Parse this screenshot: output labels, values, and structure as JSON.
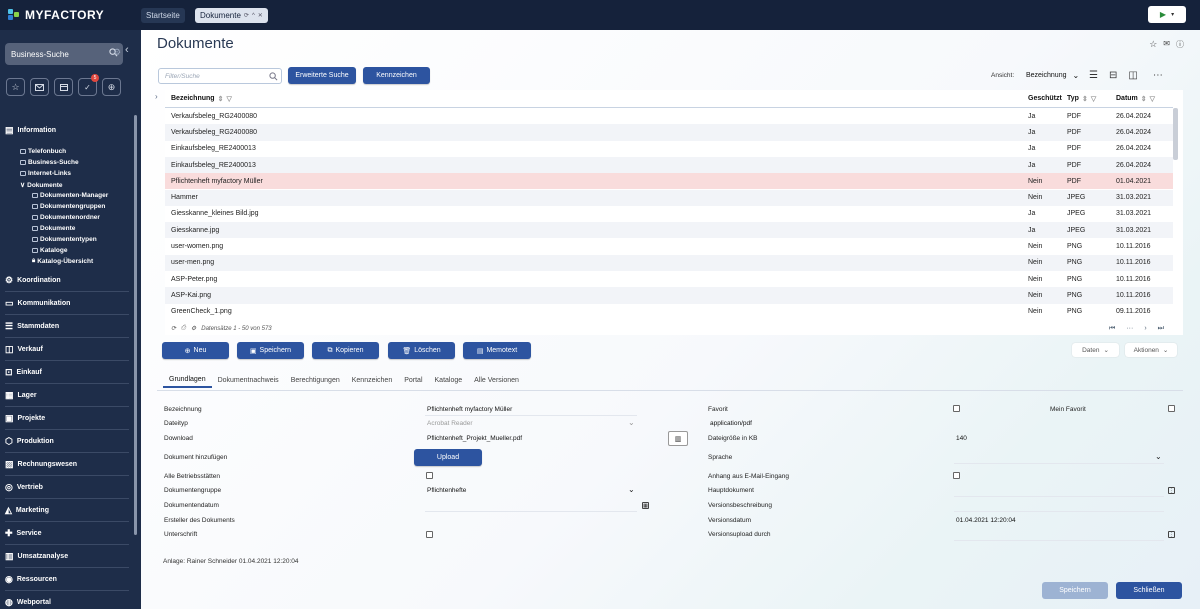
{
  "app": {
    "name": "MYFACTORY"
  },
  "tabs": [
    {
      "label": "Startseite"
    },
    {
      "label": "Dokumente"
    }
  ],
  "sidebar": {
    "search_label": "Business-Suche",
    "quick_badge": "5",
    "sections": [
      {
        "label": "Information"
      },
      {
        "label": "Koordination"
      },
      {
        "label": "Kommunikation"
      },
      {
        "label": "Stammdaten"
      },
      {
        "label": "Verkauf"
      },
      {
        "label": "Einkauf"
      },
      {
        "label": "Lager"
      },
      {
        "label": "Projekte"
      },
      {
        "label": "Produktion"
      },
      {
        "label": "Rechnungswesen"
      },
      {
        "label": "Vertrieb"
      },
      {
        "label": "Marketing"
      },
      {
        "label": "Service"
      },
      {
        "label": "Umsatzanalyse"
      },
      {
        "label": "Ressourcen"
      },
      {
        "label": "Webportal"
      }
    ],
    "tree": [
      {
        "label": "Telefonbuch"
      },
      {
        "label": "Business-Suche"
      },
      {
        "label": "Internet-Links"
      },
      {
        "label": "Dokumente"
      },
      {
        "label": "Dokumenten-Manager"
      },
      {
        "label": "Dokumentengruppen"
      },
      {
        "label": "Dokumentenordner"
      },
      {
        "label": "Dokumente"
      },
      {
        "label": "Dokumententypen"
      },
      {
        "label": "Kataloge"
      },
      {
        "label": "Katalog-Übersicht"
      }
    ]
  },
  "page": {
    "title": "Dokumente"
  },
  "toolbar": {
    "filter_placeholder": "Filter/Suche",
    "extended_search": "Erweiterte Suche",
    "tags": "Kennzeichen",
    "view_label": "Ansicht:",
    "view_value": "Bezeichnung"
  },
  "grid": {
    "headers": {
      "name": "Bezeichnung",
      "protected": "Geschützt",
      "type": "Typ",
      "date": "Datum"
    },
    "rows": [
      {
        "name": "Verkaufsbeleg_RG2400080",
        "protected": "Ja",
        "type": "PDF",
        "date": "26.04.2024"
      },
      {
        "name": "Verkaufsbeleg_RG2400080",
        "protected": "Ja",
        "type": "PDF",
        "date": "26.04.2024"
      },
      {
        "name": "Einkaufsbeleg_RE2400013",
        "protected": "Ja",
        "type": "PDF",
        "date": "26.04.2024"
      },
      {
        "name": "Einkaufsbeleg_RE2400013",
        "protected": "Ja",
        "type": "PDF",
        "date": "26.04.2024"
      },
      {
        "name": "Pflichtenheft myfactory Müller",
        "protected": "Nein",
        "type": "PDF",
        "date": "01.04.2021"
      },
      {
        "name": "Hammer",
        "protected": "Nein",
        "type": "JPEG",
        "date": "31.03.2021"
      },
      {
        "name": "Giesskanne_kleines Bild.jpg",
        "protected": "Ja",
        "type": "JPEG",
        "date": "31.03.2021"
      },
      {
        "name": "Giesskanne.jpg",
        "protected": "Ja",
        "type": "JPEG",
        "date": "31.03.2021"
      },
      {
        "name": "user-women.png",
        "protected": "Nein",
        "type": "PNG",
        "date": "10.11.2016"
      },
      {
        "name": "user-men.png",
        "protected": "Nein",
        "type": "PNG",
        "date": "10.11.2016"
      },
      {
        "name": "ASP-Peter.png",
        "protected": "Nein",
        "type": "PNG",
        "date": "10.11.2016"
      },
      {
        "name": "ASP-Kai.png",
        "protected": "Nein",
        "type": "PNG",
        "date": "10.11.2016"
      },
      {
        "name": "GreenCheck_1.png",
        "protected": "Nein",
        "type": "PNG",
        "date": "09.11.2016"
      }
    ],
    "footer": "Datensätze 1 - 50 von 573",
    "pager_more": "···"
  },
  "actions": {
    "new": "Neu",
    "save": "Speichern",
    "copy": "Kopieren",
    "delete": "Löschen",
    "memo": "Memotext",
    "data": "Daten",
    "more": "Aktionen"
  },
  "detail_tabs": [
    {
      "label": "Grundlagen"
    },
    {
      "label": "Dokumentnachweis"
    },
    {
      "label": "Berechtigungen"
    },
    {
      "label": "Kennzeichen"
    },
    {
      "label": "Portal"
    },
    {
      "label": "Kataloge"
    },
    {
      "label": "Alle Versionen"
    }
  ],
  "form": {
    "bezeichnung_label": "Bezeichnung",
    "bezeichnung_value": "Pflichtenheft myfactory Müller",
    "dateityp_label": "Dateityp",
    "dateityp_value": "Acrobat Reader",
    "download_label": "Download",
    "download_value": "Pflichtenheft_Projekt_Mueller.pdf",
    "add_doc_label": "Dokument hinzufügen",
    "upload_label": "Upload",
    "alle_label": "Alle Betriebsstätten",
    "gruppe_label": "Dokumentengruppe",
    "gruppe_value": "Pflichtenhefte",
    "datum_label": "Dokumentendatum",
    "ersteller_label": "Ersteller des Dokuments",
    "unterschrift_label": "Unterschrift",
    "favorit_label": "Favorit",
    "mein_favorit_label": "Mein Favorit",
    "mime_value": "application/pdf",
    "size_label": "Dateigröße in KB",
    "size_value": "140",
    "sprache_label": "Sprache",
    "anhang_label": "Anhang aus E-Mail-Eingang",
    "haupt_label": "Hauptdokument",
    "vbeschreibung_label": "Versionsbeschreibung",
    "vdatum_label": "Versionsdatum",
    "vdatum_value": "01.04.2021 12:20:04",
    "vupload_label": "Versionsupload durch"
  },
  "anlage": "Anlage: Rainer Schneider 01.04.2021 12:20:04",
  "footer": {
    "save": "Speichern",
    "close": "Schließen"
  }
}
